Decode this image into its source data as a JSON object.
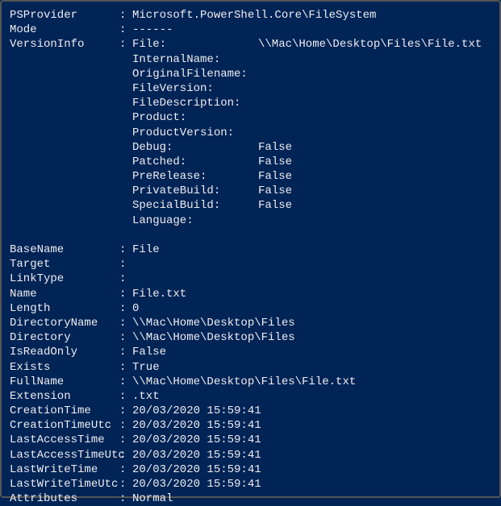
{
  "properties": {
    "PSProvider": "Microsoft.PowerShell.Core\\FileSystem",
    "Mode": "------",
    "BaseName": "File",
    "Target": "",
    "LinkType": "",
    "Name": "File.txt",
    "Length": "0",
    "DirectoryName": "\\\\Mac\\Home\\Desktop\\Files",
    "Directory": "\\\\Mac\\Home\\Desktop\\Files",
    "IsReadOnly": "False",
    "Exists": "True",
    "FullName": "\\\\Mac\\Home\\Desktop\\Files\\File.txt",
    "Extension": ".txt",
    "CreationTime": "20/03/2020 15:59:41",
    "CreationTimeUtc": "20/03/2020 15:59:41",
    "LastAccessTime": "20/03/2020 15:59:41",
    "LastAccessTimeUtc": "20/03/2020 15:59:41",
    "LastWriteTime": "20/03/2020 15:59:41",
    "LastWriteTimeUtc": "20/03/2020 15:59:41",
    "Attributes": "Normal"
  },
  "labels": {
    "PSProvider": "PSProvider",
    "Mode": "Mode",
    "VersionInfo": "VersionInfo",
    "BaseName": "BaseName",
    "Target": "Target",
    "LinkType": "LinkType",
    "Name": "Name",
    "Length": "Length",
    "DirectoryName": "DirectoryName",
    "Directory": "Directory",
    "IsReadOnly": "IsReadOnly",
    "Exists": "Exists",
    "FullName": "FullName",
    "Extension": "Extension",
    "CreationTime": "CreationTime",
    "CreationTimeUtc": "CreationTimeUtc",
    "LastAccessTime": "LastAccessTime",
    "LastAccessTimeUtc": "LastAccessTimeUtc",
    "LastWriteTime": "LastWriteTime",
    "LastWriteTimeUtc": "LastWriteTimeUtc",
    "Attributes": "Attributes"
  },
  "versionInfo": {
    "File_label": "File:",
    "File_value": "\\\\Mac\\Home\\Desktop\\Files\\File.txt",
    "InternalName_label": "InternalName:",
    "InternalName_value": "",
    "OriginalFilename_label": "OriginalFilename:",
    "OriginalFilename_value": "",
    "FileVersion_label": "FileVersion:",
    "FileVersion_value": "",
    "FileDescription_label": "FileDescription:",
    "FileDescription_value": "",
    "Product_label": "Product:",
    "Product_value": "",
    "ProductVersion_label": "ProductVersion:",
    "ProductVersion_value": "",
    "Debug_label": "Debug:",
    "Debug_value": "False",
    "Patched_label": "Patched:",
    "Patched_value": "False",
    "PreRelease_label": "PreRelease:",
    "PreRelease_value": "False",
    "PrivateBuild_label": "PrivateBuild:",
    "PrivateBuild_value": "False",
    "SpecialBuild_label": "SpecialBuild:",
    "SpecialBuild_value": "False",
    "Language_label": "Language:",
    "Language_value": ""
  },
  "separator": ":"
}
